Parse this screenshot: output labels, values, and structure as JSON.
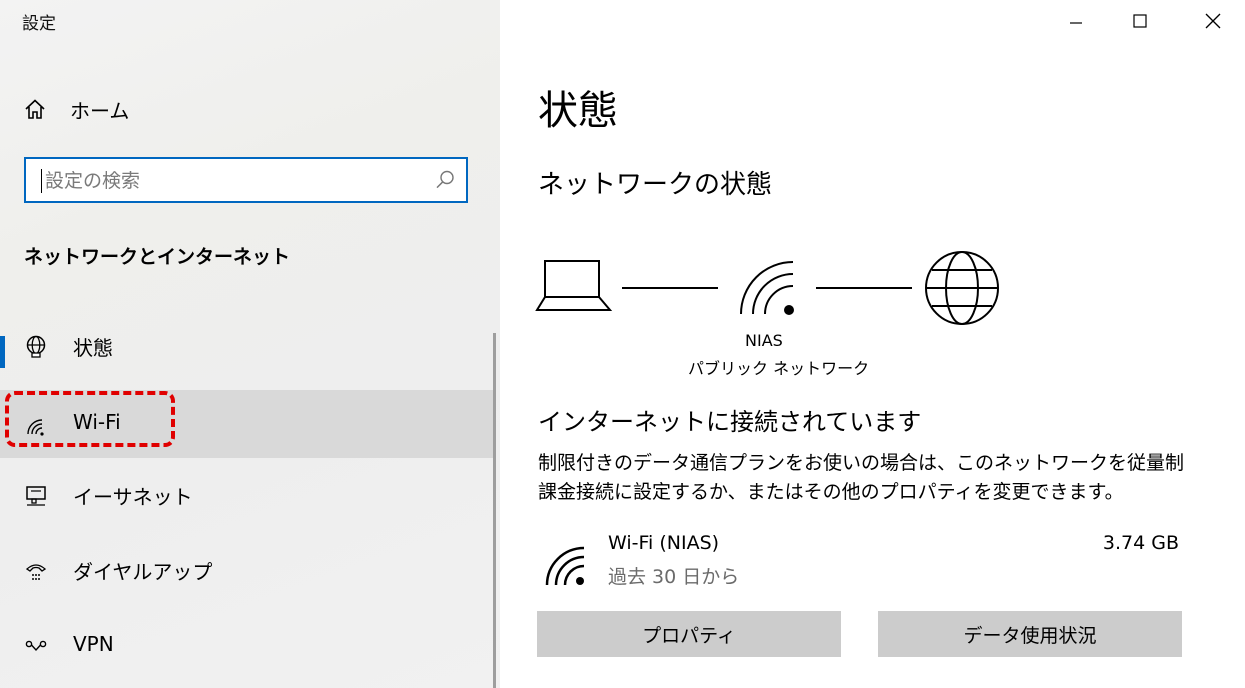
{
  "window": {
    "title": "設定"
  },
  "sidebar": {
    "home_label": "ホーム",
    "search_placeholder": "設定の検索",
    "section_title": "ネットワークとインターネット",
    "items": [
      {
        "label": "状態",
        "icon": "globe-monitor-icon"
      },
      {
        "label": "Wi-Fi",
        "icon": "wifi-icon"
      },
      {
        "label": "イーサネット",
        "icon": "ethernet-icon"
      },
      {
        "label": "ダイヤルアップ",
        "icon": "dialup-icon"
      },
      {
        "label": "VPN",
        "icon": "vpn-icon"
      }
    ]
  },
  "main": {
    "title": "状態",
    "subtitle": "ネットワークの状態",
    "network_name": "NIAS",
    "network_type": "パブリック ネットワーク",
    "status_heading": "インターネットに接続されています",
    "status_description": "制限付きのデータ通信プランをお使いの場合は、このネットワークを従量制課金接続に設定するか、またはその他のプロパティを変更できます。",
    "usage": {
      "name": "Wi-Fi (NIAS)",
      "period": "過去 30 日から",
      "amount": "3.74 GB"
    },
    "buttons": {
      "properties": "プロパティ",
      "data_usage": "データ使用状況"
    }
  },
  "colors": {
    "accent": "#0067c0",
    "highlight": "#e00000",
    "button_bg": "#cccccc"
  }
}
